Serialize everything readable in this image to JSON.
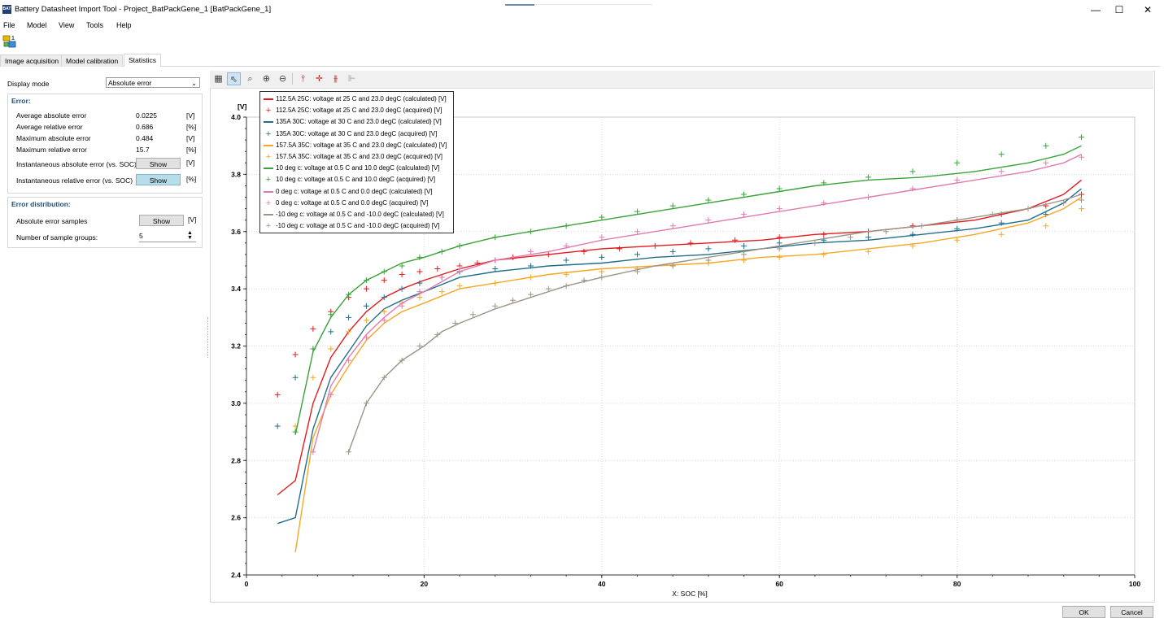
{
  "window": {
    "app_icon_text": "BAT",
    "title": "Battery Datasheet Import Tool - Project_BatPackGene_1 [BatPackGene_1]",
    "minimize": "—",
    "maximize": "☐",
    "close": "✕"
  },
  "menu": [
    "File",
    "Model",
    "View",
    "Tools",
    "Help"
  ],
  "tabs": [
    "Image acquisition",
    "Model calibration",
    "Statistics"
  ],
  "left": {
    "display_mode_label": "Display mode",
    "display_mode_value": "Absolute error",
    "error_title": "Error:",
    "rows": [
      {
        "label": "Average absolute error",
        "value": "0.0225",
        "unit": "[V]"
      },
      {
        "label": "Average relative error",
        "value": "0.686",
        "unit": "[%]"
      },
      {
        "label": "Maximum absolute error",
        "value": "0.484",
        "unit": "[V]"
      },
      {
        "label": "Maximum relative error",
        "value": "15.7",
        "unit": "[%]"
      }
    ],
    "inst_abs_label": "Instantaneous absolute error (vs. SOC)",
    "inst_abs_unit": "[V]",
    "inst_rel_label": "Instantaneous relative error (vs. SOC)",
    "inst_rel_unit": "[%]",
    "show_label": "Show",
    "dist_title": "Error distribution:",
    "abs_samples_label": "Absolute error samples",
    "abs_samples_unit": "[V]",
    "groups_label": "Number of sample groups:",
    "groups_value": "5",
    "spin_up": "▲",
    "spin_down": "▼"
  },
  "buttons": {
    "ok": "OK",
    "cancel": "Cancel"
  },
  "chart_data": {
    "type": "line",
    "xlabel": "X: SOC [%]",
    "ylabel": "[V]",
    "xlim": [
      0,
      100
    ],
    "ylim": [
      2.4,
      4.0
    ],
    "xticks": [
      0,
      20,
      40,
      60,
      80,
      100
    ],
    "yticks": [
      2.4,
      2.6,
      2.8,
      3.0,
      3.2,
      3.4,
      3.6,
      3.8,
      4.0
    ],
    "grid": true,
    "legend_position": "top-left",
    "series": [
      {
        "name": "112.5A 25C: voltage at 25 C and 23.0 degC (calculated) [V]",
        "color": "#e41a1c",
        "style": "line",
        "x": [
          3.5,
          5.5,
          7.5,
          9.5,
          11.5,
          13.5,
          15.5,
          17.5,
          20,
          24,
          28,
          34,
          40,
          46,
          52,
          58,
          64,
          70,
          76,
          82,
          88,
          92,
          94
        ],
        "y": [
          2.68,
          2.73,
          3.0,
          3.16,
          3.25,
          3.32,
          3.37,
          3.4,
          3.43,
          3.47,
          3.5,
          3.52,
          3.54,
          3.55,
          3.56,
          3.57,
          3.59,
          3.6,
          3.62,
          3.64,
          3.68,
          3.73,
          3.78
        ]
      },
      {
        "name": "112.5A 25C: voltage at 25 C and 23.0 degC (acquired) [V]",
        "color": "#e41a1c",
        "style": "marker",
        "x": [
          3.5,
          5.5,
          7.5,
          9.5,
          11.5,
          13.5,
          15.5,
          17.5,
          19.5,
          21.5,
          24,
          26,
          28,
          30,
          34,
          38,
          42,
          46,
          50,
          55,
          60,
          65,
          70,
          75,
          80,
          85,
          90,
          94
        ],
        "y": [
          3.03,
          3.17,
          3.26,
          3.32,
          3.37,
          3.4,
          3.43,
          3.45,
          3.46,
          3.47,
          3.48,
          3.49,
          3.5,
          3.51,
          3.52,
          3.53,
          3.54,
          3.55,
          3.56,
          3.57,
          3.58,
          3.59,
          3.6,
          3.62,
          3.64,
          3.66,
          3.69,
          3.73
        ]
      },
      {
        "name": "135A 30C: voltage at 30 C and 23.0 degC (calculated) [V]",
        "color": "#1f6f8b",
        "style": "line",
        "x": [
          3.5,
          5.5,
          7.5,
          9.5,
          11.5,
          13.5,
          15.5,
          17.5,
          20,
          24,
          28,
          34,
          40,
          46,
          52,
          58,
          64,
          70,
          76,
          82,
          88,
          92,
          94
        ],
        "y": [
          2.58,
          2.6,
          2.91,
          3.09,
          3.18,
          3.27,
          3.33,
          3.36,
          3.39,
          3.44,
          3.46,
          3.48,
          3.49,
          3.51,
          3.52,
          3.54,
          3.56,
          3.57,
          3.59,
          3.61,
          3.64,
          3.7,
          3.75
        ]
      },
      {
        "name": "135A 30C: voltage at 30 C and 23.0 degC (acquired) [V]",
        "color": "#1f6f8b",
        "style": "marker",
        "x": [
          3.5,
          5.5,
          7.5,
          9.5,
          11.5,
          13.5,
          15.5,
          17.5,
          19.5,
          22,
          24,
          28,
          32,
          36,
          40,
          44,
          48,
          52,
          56,
          60,
          65,
          70,
          75,
          80,
          85,
          90,
          94
        ],
        "y": [
          2.92,
          3.09,
          3.19,
          3.25,
          3.3,
          3.34,
          3.37,
          3.4,
          3.42,
          3.44,
          3.46,
          3.47,
          3.48,
          3.5,
          3.51,
          3.52,
          3.53,
          3.54,
          3.55,
          3.56,
          3.57,
          3.58,
          3.59,
          3.61,
          3.63,
          3.66,
          3.71
        ]
      },
      {
        "name": "157.5A 35C: voltage at 35 C and 23.0 degC (calculated) [V]",
        "color": "#f5a623",
        "style": "line",
        "x": [
          5.5,
          7.5,
          9.5,
          11.5,
          13.5,
          15.5,
          17.5,
          20,
          24,
          28,
          34,
          40,
          46,
          52,
          58,
          64,
          70,
          76,
          82,
          88,
          92,
          94
        ],
        "y": [
          2.48,
          2.88,
          3.03,
          3.13,
          3.22,
          3.28,
          3.32,
          3.35,
          3.4,
          3.42,
          3.45,
          3.47,
          3.48,
          3.49,
          3.51,
          3.52,
          3.54,
          3.56,
          3.59,
          3.63,
          3.68,
          3.72
        ]
      },
      {
        "name": "157.5A 35C: voltage at 35 C and 23.0 degC (acquired) [V]",
        "color": "#f5a623",
        "style": "marker",
        "x": [
          5.5,
          7.5,
          9.5,
          11.5,
          13.5,
          15.5,
          17.5,
          19.5,
          22,
          24,
          28,
          32,
          36,
          40,
          44,
          48,
          52,
          56,
          60,
          65,
          70,
          75,
          80,
          85,
          90,
          94
        ],
        "y": [
          2.92,
          3.09,
          3.19,
          3.25,
          3.29,
          3.32,
          3.35,
          3.37,
          3.39,
          3.41,
          3.42,
          3.44,
          3.45,
          3.46,
          3.47,
          3.48,
          3.49,
          3.5,
          3.51,
          3.52,
          3.53,
          3.55,
          3.57,
          3.59,
          3.62,
          3.68
        ]
      },
      {
        "name": "10 deg c: voltage at 0.5 C and 10.0 degC (calculated) [V]",
        "color": "#3aa23a",
        "style": "line",
        "x": [
          5.5,
          7.5,
          9.5,
          11.5,
          13.5,
          15.5,
          17.5,
          20,
          24,
          28,
          34,
          40,
          46,
          52,
          58,
          64,
          70,
          76,
          82,
          88,
          92,
          94
        ],
        "y": [
          2.89,
          3.18,
          3.3,
          3.38,
          3.43,
          3.46,
          3.49,
          3.51,
          3.55,
          3.58,
          3.61,
          3.64,
          3.67,
          3.7,
          3.73,
          3.76,
          3.78,
          3.79,
          3.81,
          3.84,
          3.87,
          3.9
        ]
      },
      {
        "name": "10 deg c: voltage at 0.5 C and 10.0 degC (acquired) [V]",
        "color": "#3aa23a",
        "style": "marker",
        "x": [
          5.5,
          7.5,
          9.5,
          11.5,
          13.5,
          15.5,
          17.5,
          19.5,
          22,
          24,
          28,
          32,
          36,
          40,
          44,
          48,
          52,
          56,
          60,
          65,
          70,
          75,
          80,
          85,
          90,
          94
        ],
        "y": [
          2.9,
          3.19,
          3.31,
          3.38,
          3.43,
          3.46,
          3.48,
          3.51,
          3.53,
          3.55,
          3.58,
          3.6,
          3.62,
          3.65,
          3.67,
          3.69,
          3.71,
          3.73,
          3.75,
          3.77,
          3.79,
          3.81,
          3.84,
          3.87,
          3.9,
          3.93
        ]
      },
      {
        "name": "0 deg c: voltage at 0.5 C and 0.0 degC (calculated) [V]",
        "color": "#e07bb0",
        "style": "line",
        "x": [
          7.5,
          9.5,
          11.5,
          13.5,
          15.5,
          17.5,
          20,
          24,
          28,
          34,
          40,
          46,
          52,
          58,
          64,
          70,
          76,
          82,
          88,
          92,
          94
        ],
        "y": [
          2.83,
          3.06,
          3.16,
          3.24,
          3.3,
          3.35,
          3.39,
          3.46,
          3.5,
          3.53,
          3.57,
          3.6,
          3.63,
          3.66,
          3.69,
          3.72,
          3.75,
          3.78,
          3.81,
          3.84,
          3.87
        ]
      },
      {
        "name": "0 deg c: voltage at 0.5 C and 0.0 degC (acquired) [V]",
        "color": "#e07bb0",
        "style": "marker",
        "x": [
          7.5,
          9.5,
          11.5,
          13.5,
          15.5,
          17.5,
          19.5,
          22,
          24,
          28,
          32,
          36,
          40,
          44,
          48,
          52,
          56,
          60,
          65,
          70,
          75,
          80,
          85,
          90,
          94
        ],
        "y": [
          2.83,
          3.03,
          3.15,
          3.23,
          3.29,
          3.34,
          3.39,
          3.44,
          3.47,
          3.5,
          3.53,
          3.55,
          3.58,
          3.6,
          3.62,
          3.64,
          3.66,
          3.68,
          3.7,
          3.72,
          3.75,
          3.78,
          3.81,
          3.84,
          3.86
        ]
      },
      {
        "name": "-10 deg c: voltage at 0.5 C and -10.0 degC (calculated) [V]",
        "color": "#9b9588",
        "style": "line",
        "x": [
          11.5,
          13.5,
          15.5,
          17.5,
          20,
          22,
          24,
          28,
          32,
          36,
          40,
          46,
          52,
          58,
          64,
          70,
          76,
          82,
          88,
          92,
          94
        ],
        "y": [
          2.83,
          3.0,
          3.09,
          3.15,
          3.2,
          3.25,
          3.28,
          3.33,
          3.37,
          3.41,
          3.44,
          3.48,
          3.51,
          3.54,
          3.57,
          3.6,
          3.62,
          3.65,
          3.68,
          3.71,
          3.73
        ]
      },
      {
        "name": "-10 deg c: voltage at 0.5 C and -10.0 degC (acquired) [V]",
        "color": "#9b9588",
        "style": "marker",
        "x": [
          11.5,
          13.5,
          15.5,
          17.5,
          19.5,
          21.5,
          23.5,
          25.5,
          28,
          30,
          32,
          34,
          36,
          38,
          40,
          44,
          48,
          52,
          56,
          60,
          64,
          68,
          72,
          76,
          80,
          84,
          88,
          92,
          94
        ],
        "y": [
          2.83,
          3.0,
          3.09,
          3.15,
          3.2,
          3.24,
          3.28,
          3.31,
          3.34,
          3.36,
          3.38,
          3.4,
          3.41,
          3.43,
          3.44,
          3.46,
          3.48,
          3.5,
          3.52,
          3.54,
          3.56,
          3.58,
          3.6,
          3.62,
          3.64,
          3.66,
          3.68,
          3.7,
          3.71
        ]
      }
    ]
  }
}
